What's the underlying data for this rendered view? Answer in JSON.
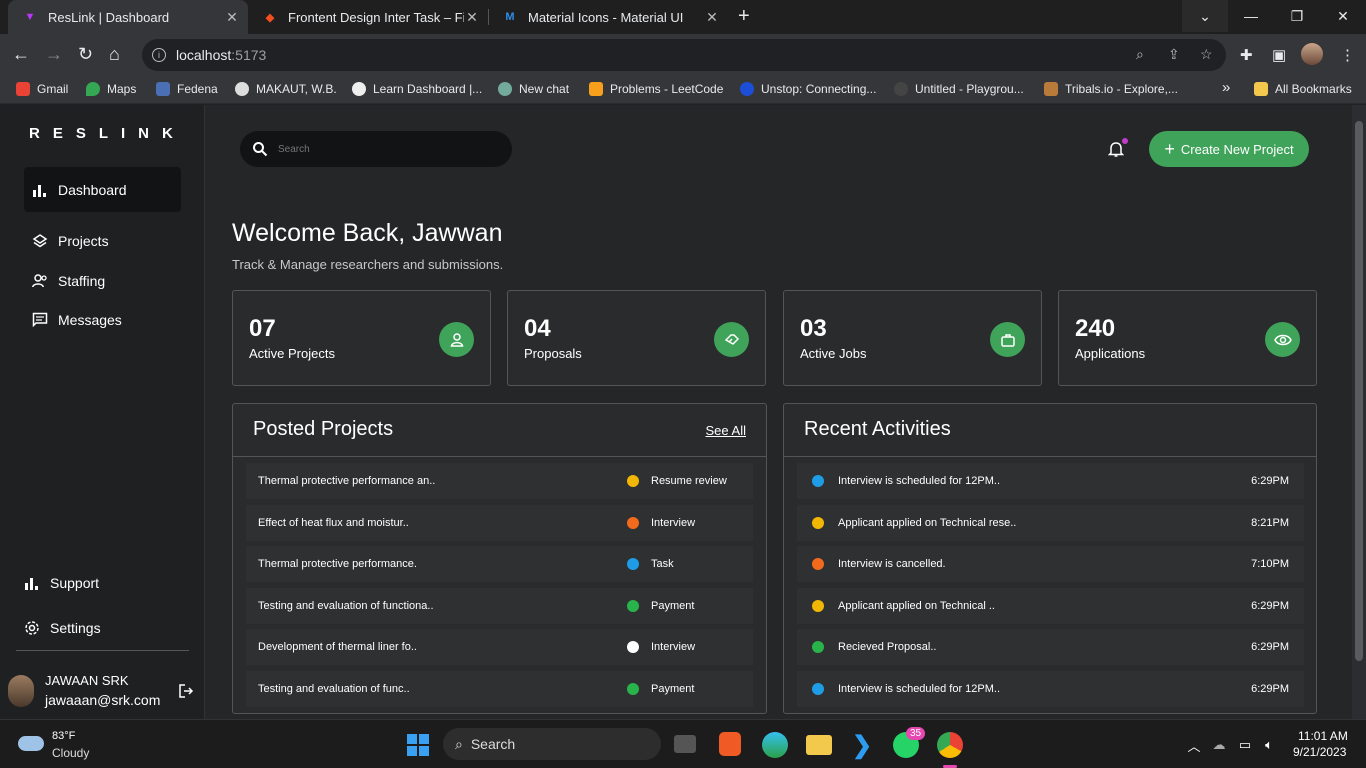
{
  "browser": {
    "tabs": [
      {
        "title": "ResLink | Dashboard",
        "active": true
      },
      {
        "title": "Frontent Design Inter Task – Figm",
        "active": false
      },
      {
        "title": "Material Icons - Material UI",
        "active": false
      }
    ],
    "url_host": "localhost",
    "url_port": ":5173",
    "bookmarks": [
      "Gmail",
      "Maps",
      "Fedena",
      "MAKAUT, W.B.",
      "Learn Dashboard |...",
      "New chat",
      "Problems - LeetCode",
      "Unstop: Connecting...",
      "Untitled - Playgrou...",
      "Tribals.io - Explore,..."
    ],
    "bookmarks_more": "»",
    "all_bookmarks": "All Bookmarks"
  },
  "sidebar": {
    "logo": "RESLINK",
    "items": [
      {
        "label": "Dashboard",
        "icon": "bar-chart-icon",
        "active": true
      },
      {
        "label": "Projects",
        "icon": "layers-icon",
        "active": false
      },
      {
        "label": "Staffing",
        "icon": "people-icon",
        "active": false
      },
      {
        "label": "Messages",
        "icon": "chat-icon",
        "active": false
      }
    ],
    "bottom": [
      {
        "label": "Support",
        "icon": "bar-chart-icon"
      },
      {
        "label": "Settings",
        "icon": "gear-icon"
      }
    ],
    "user": {
      "name": "JAWAAN SRK",
      "email": "jawaaan@srk.com"
    }
  },
  "header": {
    "search_placeholder": "Search",
    "cta": "Create New Project"
  },
  "welcome": {
    "title": "Welcome Back, Jawwan",
    "subtitle": "Track & Manage researchers and submissions."
  },
  "stats": [
    {
      "value": "07",
      "label": "Active Projects",
      "icon": "person-icon"
    },
    {
      "value": "04",
      "label": "Proposals",
      "icon": "handshake-icon"
    },
    {
      "value": "03",
      "label": "Active Jobs",
      "icon": "briefcase-icon"
    },
    {
      "value": "240",
      "label": "Applications",
      "icon": "eye-icon"
    }
  ],
  "posted_projects": {
    "title": "Posted Projects",
    "see_all": "See All",
    "rows": [
      {
        "title": "Thermal protective performance an..",
        "status": "Resume review",
        "color": "#f2b705"
      },
      {
        "title": "Effect of heat flux and moistur..",
        "status": "Interview",
        "color": "#f26b1d"
      },
      {
        "title": "Thermal protective performance.",
        "status": "Task",
        "color": "#1e9de6"
      },
      {
        "title": "Testing and evaluation of functiona..",
        "status": "Payment",
        "color": "#28b34b"
      },
      {
        "title": "Development of thermal liner fo..",
        "status": "Interview",
        "color": "#ffffff"
      },
      {
        "title": "Testing and evaluation of func..",
        "status": "Payment",
        "color": "#28b34b"
      }
    ]
  },
  "recent_activities": {
    "title": "Recent Activities",
    "rows": [
      {
        "text": "Interview is scheduled for 12PM..",
        "time": "6:29PM",
        "color": "#1e9de6"
      },
      {
        "text": "Applicant applied on Technical rese..",
        "time": "8:21PM",
        "color": "#f2b705"
      },
      {
        "text": "Interview is cancelled.",
        "time": "7:10PM",
        "color": "#f26b1d"
      },
      {
        "text": "Applicant applied on Technical ..",
        "time": "6:29PM",
        "color": "#f2b705"
      },
      {
        "text": "Recieved Proposal..",
        "time": "6:29PM",
        "color": "#28b34b"
      },
      {
        "text": "Interview is scheduled for 12PM..",
        "time": "6:29PM",
        "color": "#1e9de6"
      }
    ]
  },
  "taskbar": {
    "weather_temp": "83°F",
    "weather_desc": "Cloudy",
    "search": "Search",
    "whatsapp_badge": "35",
    "time": "11:01 AM",
    "date": "9/21/2023"
  }
}
